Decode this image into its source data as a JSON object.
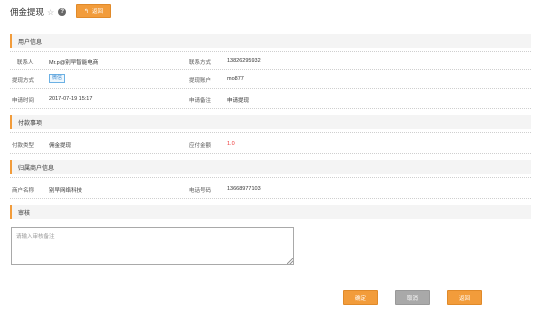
{
  "header": {
    "title": "佣金提现",
    "star_glyph": "☆",
    "help_glyph": "?",
    "back_label": "返回",
    "back_arrow": "↰"
  },
  "sections": {
    "user_info": "用户信息",
    "payment": "付款事项",
    "merchant": "归属商户信息",
    "review": "审核"
  },
  "user_info": {
    "contact_label": "联系人",
    "contact_value": "Mr.p@别早智能电商",
    "phone_label": "联系方式",
    "phone_value": "13826295932",
    "method_label": "提现方式",
    "method_value": "微信",
    "account_label": "提现账户",
    "account_value": "mo877",
    "time_label": "申请时间",
    "time_value": "2017-07-19 15:17",
    "remark_label": "申请备注",
    "remark_value": "申请提现"
  },
  "payment": {
    "type_label": "付款类型",
    "type_value": "佣金提现",
    "amount_label": "应付金额",
    "amount_value": "1.0"
  },
  "merchant": {
    "name_label": "商户名称",
    "name_value": "别早网络科技",
    "tel_label": "电话号码",
    "tel_value": "13668977103"
  },
  "review": {
    "placeholder": "请输入审核备注"
  },
  "buttons": {
    "confirm": "确定",
    "cancel": "取消",
    "back": "返回"
  },
  "colors": {
    "accent": "#f29c3b",
    "gray_button": "#a9a9a9",
    "amount": "#e33333",
    "badge": "#3d8bd0"
  }
}
